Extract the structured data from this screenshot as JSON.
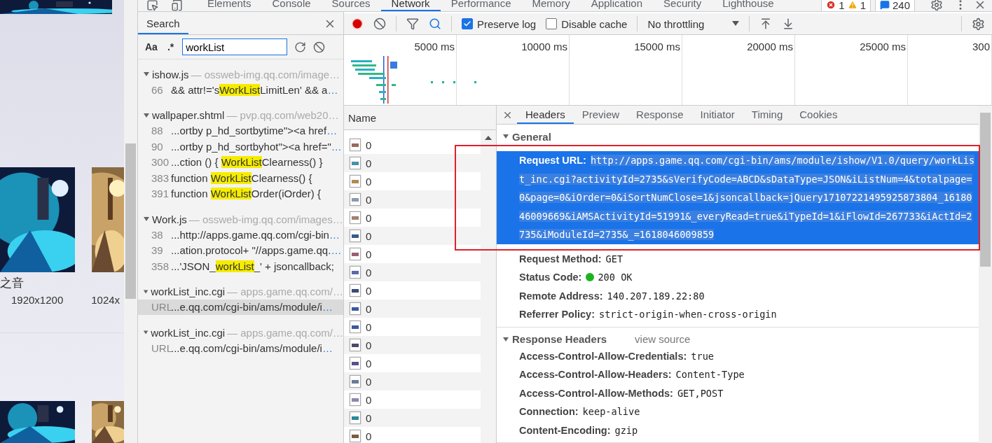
{
  "web_page": {
    "captions": [
      "之音"
    ],
    "resolutions": [
      "1920x1200",
      "1024x"
    ],
    "pictures": [
      {
        "kind": "picture"
      }
    ]
  },
  "devtools": {
    "tabs": [
      {
        "label": "Elements",
        "selected": false
      },
      {
        "label": "Console",
        "selected": false
      },
      {
        "label": "Sources",
        "selected": false
      },
      {
        "label": "Network",
        "selected": true
      },
      {
        "label": "Performance",
        "selected": false
      },
      {
        "label": "Memory",
        "selected": false
      },
      {
        "label": "Application",
        "selected": false
      },
      {
        "label": "Security",
        "selected": false
      },
      {
        "label": "Lighthouse",
        "selected": false
      }
    ],
    "errors": "1",
    "warnings": "1",
    "messages": "240"
  },
  "search": {
    "title": "Search",
    "case_toggle": "Aa",
    "regex_toggle": ".*",
    "query": "workList",
    "groups": [
      {
        "file": "ishow.js",
        "source": "— ossweb-img.qq.com/image…",
        "matches": [
          {
            "line": "66",
            "before": "&& attr!='s",
            "match": "WorkList",
            "after": "LimitLen' && a",
            "ellipsis": "…",
            "selected": false
          }
        ]
      },
      {
        "file": "wallpaper.shtml",
        "source": "— pvp.qq.com/web20…",
        "matches": [
          {
            "line": "88",
            "before": "...ortby p_hd_sortbytime\"><a href",
            "ellipsis": "…",
            "selected": false
          },
          {
            "line": "90",
            "before": "...ortby p_hd_sortbyhot\"><a href=\"",
            "ellipsis": "…",
            "selected": false
          },
          {
            "line": "300",
            "before": "...ction () { ",
            "match": "WorkList",
            "after": "Clearness() }",
            "selected": false
          },
          {
            "line": "383",
            "before": "function ",
            "match": "WorkList",
            "after": "Clearness() {",
            "selected": false
          },
          {
            "line": "391",
            "before": "function ",
            "match": "WorkList",
            "after": "Order(iOrder) {",
            "selected": false
          }
        ]
      },
      {
        "file": "Work.js",
        "source": "— ossweb-img.qq.com/images…",
        "matches": [
          {
            "line": "38",
            "before": "...http://apps.game.qq.com/cgi-bin",
            "ellipsis": "…",
            "selected": false
          },
          {
            "line": "39",
            "before": "...ation.protocol+ \"//apps.game.qq.",
            "ellipsis": "…",
            "selected": false
          },
          {
            "line": "358",
            "before": "...'JSON_",
            "match": "workList",
            "after": "_' + jsoncallback;",
            "selected": false
          }
        ]
      },
      {
        "file": "workList_inc.cgi",
        "source": "— apps.game.qq.com/…",
        "matches": [
          {
            "line": "URL",
            "before": "...e.qq.com/cgi-bin/ams/module/i",
            "ellipsis": "…",
            "selected": true
          }
        ]
      },
      {
        "file": "workList_inc.cgi",
        "source": "— apps.game.qq.com/…",
        "matches": [
          {
            "line": "URL",
            "before": "...e.qq.com/cgi-bin/ams/module/i",
            "ellipsis": "…",
            "selected": false
          }
        ]
      }
    ]
  },
  "network": {
    "preserve_log": {
      "label": "Preserve log",
      "checked": true
    },
    "disable_cache": {
      "label": "Disable cache",
      "checked": false
    },
    "throttling": "No throttling",
    "timeline_ticks": [
      "5000 ms",
      "10000 ms",
      "15000 ms",
      "20000 ms",
      "25000 ms",
      "300"
    ],
    "requests": {
      "column": "Name",
      "rows": [
        {
          "name": "0",
          "color": "#9a6a5a"
        },
        {
          "name": "0",
          "color": "#4a90a8"
        },
        {
          "name": "0",
          "color": "#b08a50"
        },
        {
          "name": "0",
          "color": "#8a9ab0"
        },
        {
          "name": "0",
          "color": "#a08070"
        },
        {
          "name": "0",
          "color": "#3a5a88"
        },
        {
          "name": "0",
          "color": "#9a6070"
        },
        {
          "name": "0",
          "color": "#5a6ab0"
        },
        {
          "name": "0",
          "color": "#3a4a78"
        },
        {
          "name": "0",
          "color": "#3a5aa0"
        },
        {
          "name": "0",
          "color": "#3a5a98"
        },
        {
          "name": "0",
          "color": "#4a4a68"
        },
        {
          "name": "0",
          "color": "#5a5088"
        },
        {
          "name": "0",
          "color": "#6a7a98"
        },
        {
          "name": "0",
          "color": "#8a88b0"
        },
        {
          "name": "0",
          "color": "#2a8a98"
        },
        {
          "name": "0",
          "color": "#7a5a40"
        }
      ]
    },
    "detail": {
      "tabs": [
        {
          "label": "Headers",
          "selected": true
        },
        {
          "label": "Preview",
          "selected": false
        },
        {
          "label": "Response",
          "selected": false
        },
        {
          "label": "Initiator",
          "selected": false
        },
        {
          "label": "Timing",
          "selected": false
        },
        {
          "label": "Cookies",
          "selected": false
        }
      ],
      "general": {
        "title": "General",
        "expanded": true,
        "fields": [
          {
            "name": "Request URL:",
            "value": "http://apps.game.qq.com/cgi-bin/ams/module/ishow/V1.0/query/workList_inc.cgi?activityId=2735&sVerifyCode=ABCD&sDataType=JSON&iListNum=4&totalpage=0&page=0&iOrder=0&iSortNumClose=1&jsoncallback=jQuery17107221495925873804_1618046009669&iAMSActivityId=51991&_everyRead=true&iTypeId=1&iFlowId=267733&iActId=2735&iModuleId=2735&_=1618046009859",
            "selected": true
          },
          {
            "name": "Request Method:",
            "value": "GET",
            "selected": false
          },
          {
            "name": "Status Code:",
            "value": "200 OK",
            "color": "#1db320",
            "selected": false
          },
          {
            "name": "Remote Address:",
            "value": "140.207.189.22:80",
            "selected": false
          },
          {
            "name": "Referrer Policy:",
            "value": "strict-origin-when-cross-origin",
            "selected": false
          }
        ]
      },
      "response_headers": {
        "title": "Response Headers",
        "expanded": true,
        "link": "view source",
        "fields": [
          {
            "name": "Access-Control-Allow-Credentials:",
            "value": "true"
          },
          {
            "name": "Access-Control-Allow-Headers:",
            "value": "Content-Type"
          },
          {
            "name": "Access-Control-Allow-Methods:",
            "value": "GET,POST"
          },
          {
            "name": "Connection:",
            "value": "keep-alive"
          },
          {
            "name": "Content-Encoding:",
            "value": "gzip"
          }
        ]
      }
    }
  }
}
